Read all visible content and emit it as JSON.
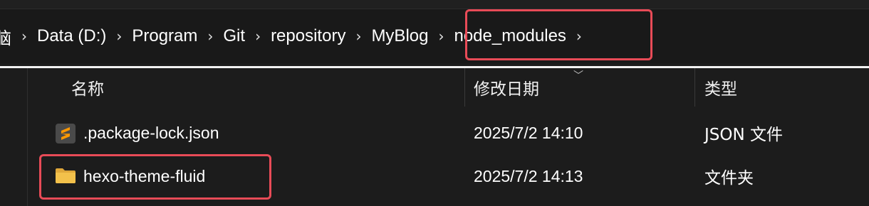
{
  "breadcrumb": {
    "items": [
      {
        "label": "脑"
      },
      {
        "label": "Data (D:)"
      },
      {
        "label": "Program"
      },
      {
        "label": "Git"
      },
      {
        "label": "repository"
      },
      {
        "label": "MyBlog"
      },
      {
        "label": "node_modules"
      }
    ],
    "separator": "›"
  },
  "columns": {
    "name": "名称",
    "modified": "修改日期",
    "type": "类型"
  },
  "files": [
    {
      "name": ".package-lock.json",
      "modified": "2025/7/2 14:10",
      "type": "JSON 文件",
      "icon": "sublime-json-icon"
    },
    {
      "name": "hexo-theme-fluid",
      "modified": "2025/7/2 14:13",
      "type": "文件夹",
      "icon": "folder-icon"
    }
  ],
  "colors": {
    "highlight": "#e84b57",
    "folder": "#f3c14b",
    "sublime": "#ff9800"
  }
}
